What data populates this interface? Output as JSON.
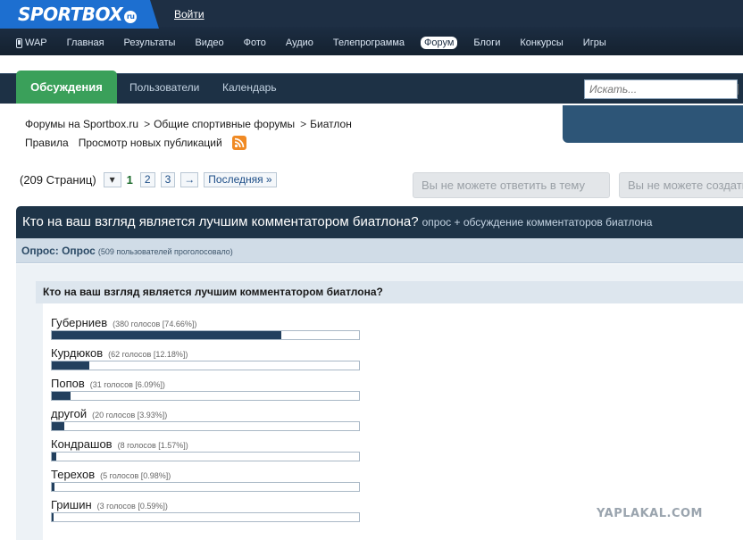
{
  "header": {
    "logo": "SPORTBOX",
    "logo_suffix": "ru",
    "login": "Войти"
  },
  "site_nav": [
    {
      "label": "WAP",
      "icon": "phone-icon"
    },
    {
      "label": "Главная"
    },
    {
      "label": "Результаты"
    },
    {
      "label": "Видео"
    },
    {
      "label": "Фото"
    },
    {
      "label": "Аудио"
    },
    {
      "label": "Телепрограмма"
    },
    {
      "label": "Форум",
      "active": true
    },
    {
      "label": "Блоги"
    },
    {
      "label": "Конкурсы"
    },
    {
      "label": "Игры"
    }
  ],
  "forum_nav": {
    "tabs": [
      "Обсуждения",
      "Пользователи",
      "Календарь"
    ],
    "search_placeholder": "Искать..."
  },
  "breadcrumb": {
    "items": [
      "Форумы на Sportbox.ru",
      "Общие спортивные форумы",
      "Биатлон"
    ],
    "separator": ">",
    "rules": "Правила",
    "new_posts": "Просмотр новых публикаций"
  },
  "pagination": {
    "count": "(209 Страниц)",
    "dropdown": "▾",
    "current": "1",
    "pages": [
      "2",
      "3"
    ],
    "next": "→",
    "last": "Последняя »"
  },
  "actions": {
    "reply_disabled": "Вы не можете ответить в тему",
    "create_disabled": "Вы не можете создать тему"
  },
  "topic": {
    "title": "Кто на ваш взгляд является лучшим комментатором биатлона?",
    "description": "опрос + обсуждение комментаторов биатлона"
  },
  "poll": {
    "title": "Опрос: Опрос",
    "voters": "(509 пользователей проголосовало)",
    "question": "Кто на ваш взгляд является лучшим комментатором биатлона?",
    "options": [
      {
        "name": "Губерниев",
        "votes": "(380 голосов [74.66%])",
        "percent": 74.66
      },
      {
        "name": "Курдюков",
        "votes": "(62 голосов [12.18%])",
        "percent": 12.18
      },
      {
        "name": "Попов",
        "votes": "(31 голосов [6.09%])",
        "percent": 6.09
      },
      {
        "name": "другой",
        "votes": "(20 голосов [3.93%])",
        "percent": 3.93
      },
      {
        "name": "Кондрашов",
        "votes": "(8 голосов [1.57%])",
        "percent": 1.57
      },
      {
        "name": "Терехов",
        "votes": "(5 голосов [0.98%])",
        "percent": 0.98
      },
      {
        "name": "Гришин",
        "votes": "(3 голосов [0.59%])",
        "percent": 0.59
      }
    ]
  },
  "watermark": "YAPLAKAL.COM",
  "colors": {
    "header_bg": "#1e2f44",
    "logo_blue": "#1d6fd0",
    "active_tab_green": "#3aa05a",
    "topic_bar": "#1e3448",
    "poll_bar_fill": "#23405e"
  }
}
